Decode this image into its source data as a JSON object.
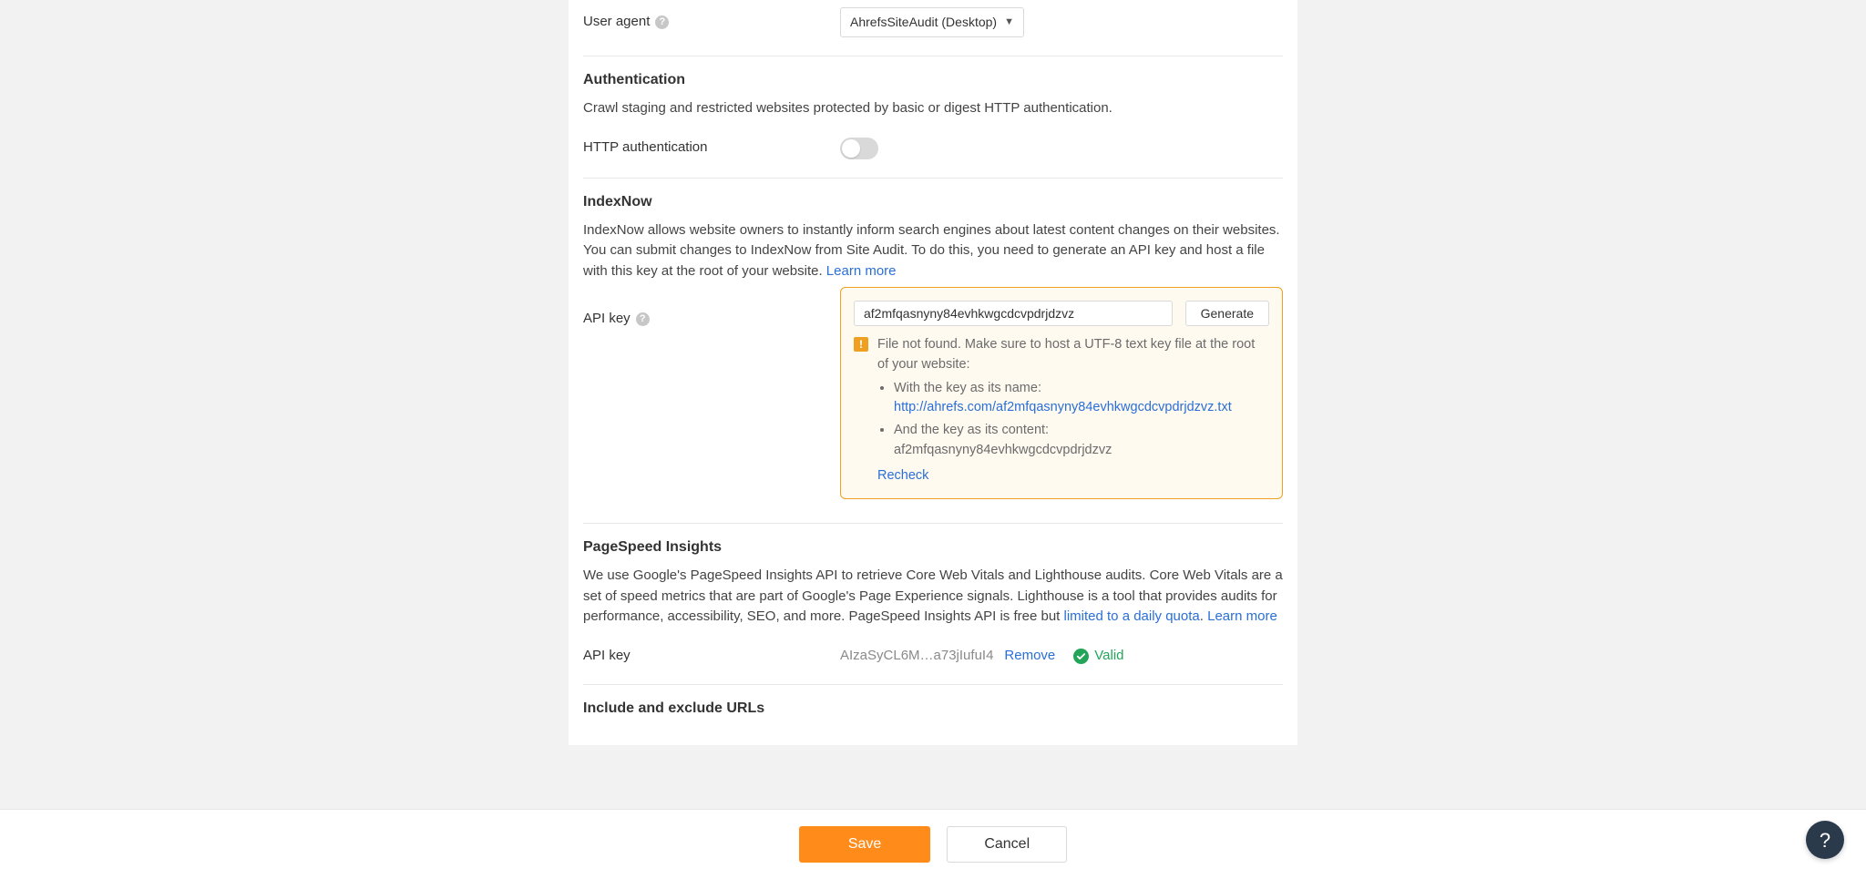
{
  "user_agent": {
    "label": "User agent",
    "selected": "AhrefsSiteAudit (Desktop)"
  },
  "authentication": {
    "heading": "Authentication",
    "desc": "Crawl staging and restricted websites protected by basic or digest HTTP authentication.",
    "toggle_label": "HTTP authentication",
    "enabled": false
  },
  "indexnow": {
    "heading": "IndexNow",
    "desc": "IndexNow allows website owners to instantly inform search engines about latest content changes on their websites. You can submit changes to IndexNow from Site Audit. To do this, you need to generate an API key and host a file with this key at the root of your website. ",
    "learn_more": "Learn more",
    "api_label": "API key",
    "api_value": "af2mfqasnyny84evhkwgcdcvpdrjdzvz",
    "generate": "Generate",
    "error_intro": "File not found. Make sure to host a UTF-8 text key file at the root of your website:",
    "bullet1_prefix": "With the key as its name: ",
    "bullet1_link": "http://ahrefs.com/af2mfqasnyny84evhkwgcdcvpdrjdzvz.txt",
    "bullet2_prefix": "And the key as its content: ",
    "bullet2_value": "af2mfqasnyny84evhkwgcdcvpdrjdzvz",
    "recheck": "Recheck"
  },
  "pagespeed": {
    "heading": "PageSpeed Insights",
    "desc_part1": "We use Google's PageSpeed Insights API to retrieve Core Web Vitals and Lighthouse audits. Core Web Vitals are a set of speed metrics that are part of Google's Page Experience signals. Lighthouse is a tool that provides audits for performance, accessibility, SEO, and more. PageSpeed Insights API is free but ",
    "quota_link": "limited to a daily quota",
    "dot": ". ",
    "learn_more": "Learn more",
    "api_label": "API key",
    "api_value": "AIzaSyCL6M…a73jIufuI4",
    "remove": "Remove",
    "valid": "Valid"
  },
  "include_exclude": {
    "heading": "Include and exclude URLs"
  },
  "footer": {
    "save": "Save",
    "cancel": "Cancel"
  }
}
